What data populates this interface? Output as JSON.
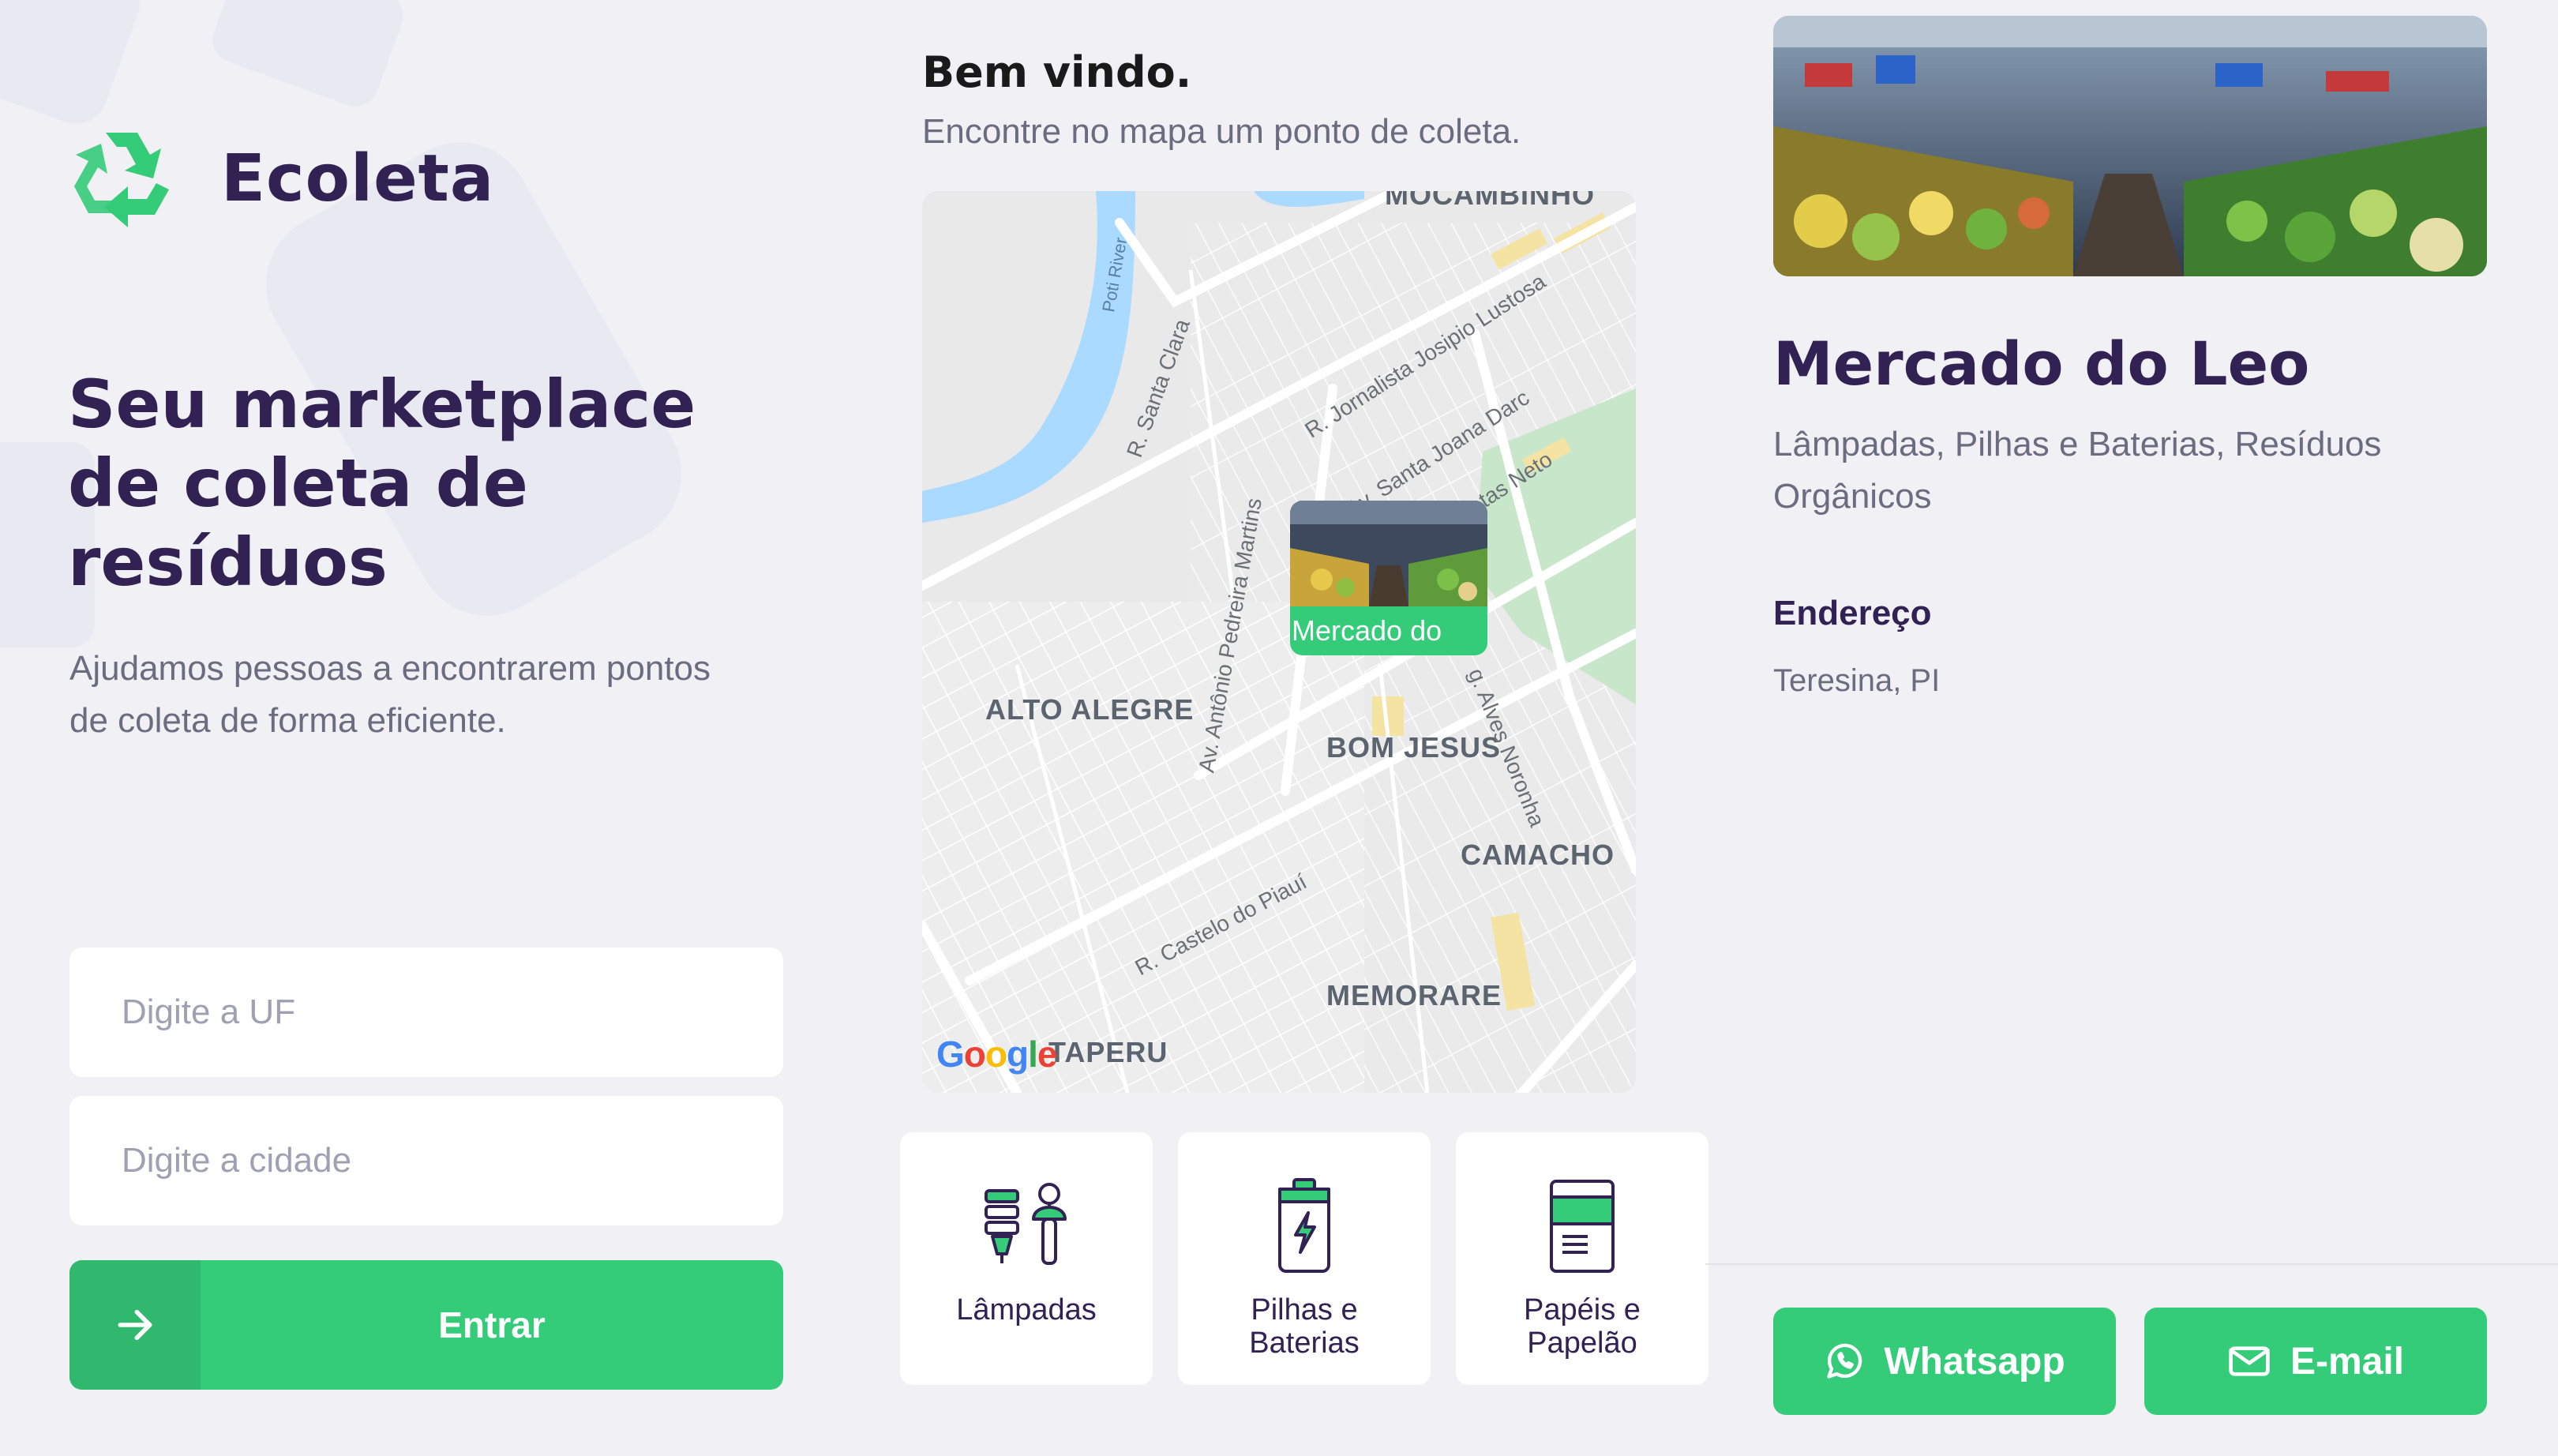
{
  "app": {
    "name": "Ecoleta"
  },
  "hero": {
    "title": "Seu marketplace de coleta de resíduos",
    "subtitle": "Ajudamos pessoas a encontrarem pontos de coleta de forma eficiente."
  },
  "form": {
    "uf_placeholder": "Digite a UF",
    "uf_value": "",
    "city_placeholder": "Digite a cidade",
    "city_value": "",
    "submit_label": "Entrar"
  },
  "welcome": {
    "title": "Bem vindo.",
    "subtitle": "Encontre no mapa um ponto de coleta."
  },
  "map": {
    "neighborhoods": [
      "MOCAMBINHO",
      "ALTO ALEGRE",
      "BOM JESUS",
      "CAMACHO",
      "MEMORARE",
      "TAPERU"
    ],
    "streets": [
      "Poti River",
      "R. Santa Clara",
      "R. Jornalista Josipio Lustosa",
      "Av. Santa Joana Darc",
      "tas Neto",
      "Av. Antônio Pedreira Martins",
      "g. Alves Noronha",
      "R. Castelo do Piauí"
    ],
    "attribution": "Google",
    "marker_label": "Mercado do"
  },
  "items": [
    {
      "label": "Lâmpadas",
      "icon": "lamp-icon"
    },
    {
      "label": "Pilhas e Baterias",
      "icon": "battery-icon"
    },
    {
      "label": "Papéis e Papelão",
      "icon": "paper-icon"
    }
  ],
  "point": {
    "name": "Mercado do Leo",
    "items": "Lâmpadas, Pilhas e Baterias, Resíduos Orgânicos",
    "address_title": "Endereço",
    "address": "Teresina, PI",
    "whatsapp_label": "Whatsapp",
    "email_label": "E-mail"
  },
  "colors": {
    "primary": "#34cb79",
    "primary_dark": "#2fb86e",
    "title": "#322153",
    "text": "#6c6c80",
    "background": "#f0f0f5"
  }
}
